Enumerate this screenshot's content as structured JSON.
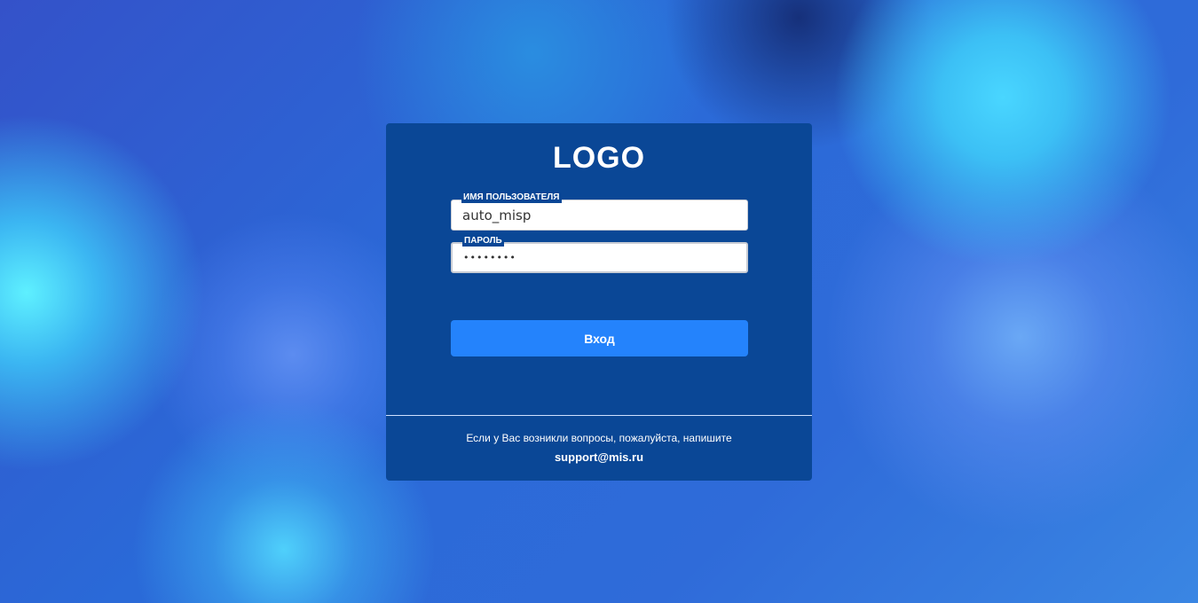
{
  "logo": "LOGO",
  "username": {
    "label": "ИМЯ ПОЛЬЗОВАТЕЛЯ",
    "value": "auto_misp"
  },
  "password": {
    "label": "ПАРОЛЬ",
    "value": "••••••••"
  },
  "login_button": "Вход",
  "footer": {
    "help_text": "Если у Вас возникли вопросы, пожалуйста, напишите",
    "email": "support@mis.ru"
  }
}
